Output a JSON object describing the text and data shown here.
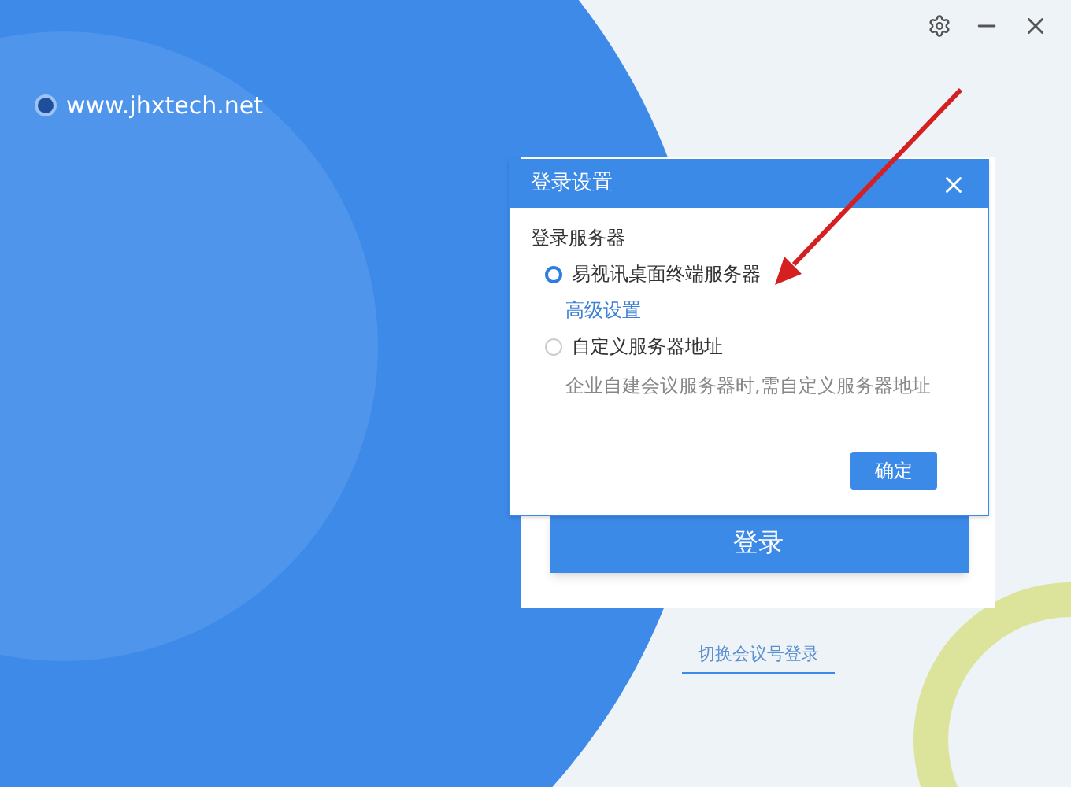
{
  "brand": {
    "website": "www.jhxtech.net"
  },
  "login": {
    "button": "登录",
    "switch_link": "切换会议号登录"
  },
  "dialog": {
    "title": "登录设置",
    "section_label": "登录服务器",
    "options": [
      {
        "label": "易视讯桌面终端服务器",
        "selected": true,
        "link": "高级设置"
      },
      {
        "label": "自定义服务器地址",
        "selected": false,
        "hint": "企业自建会议服务器时,需自定义服务器地址"
      }
    ],
    "ok_button": "确定"
  }
}
